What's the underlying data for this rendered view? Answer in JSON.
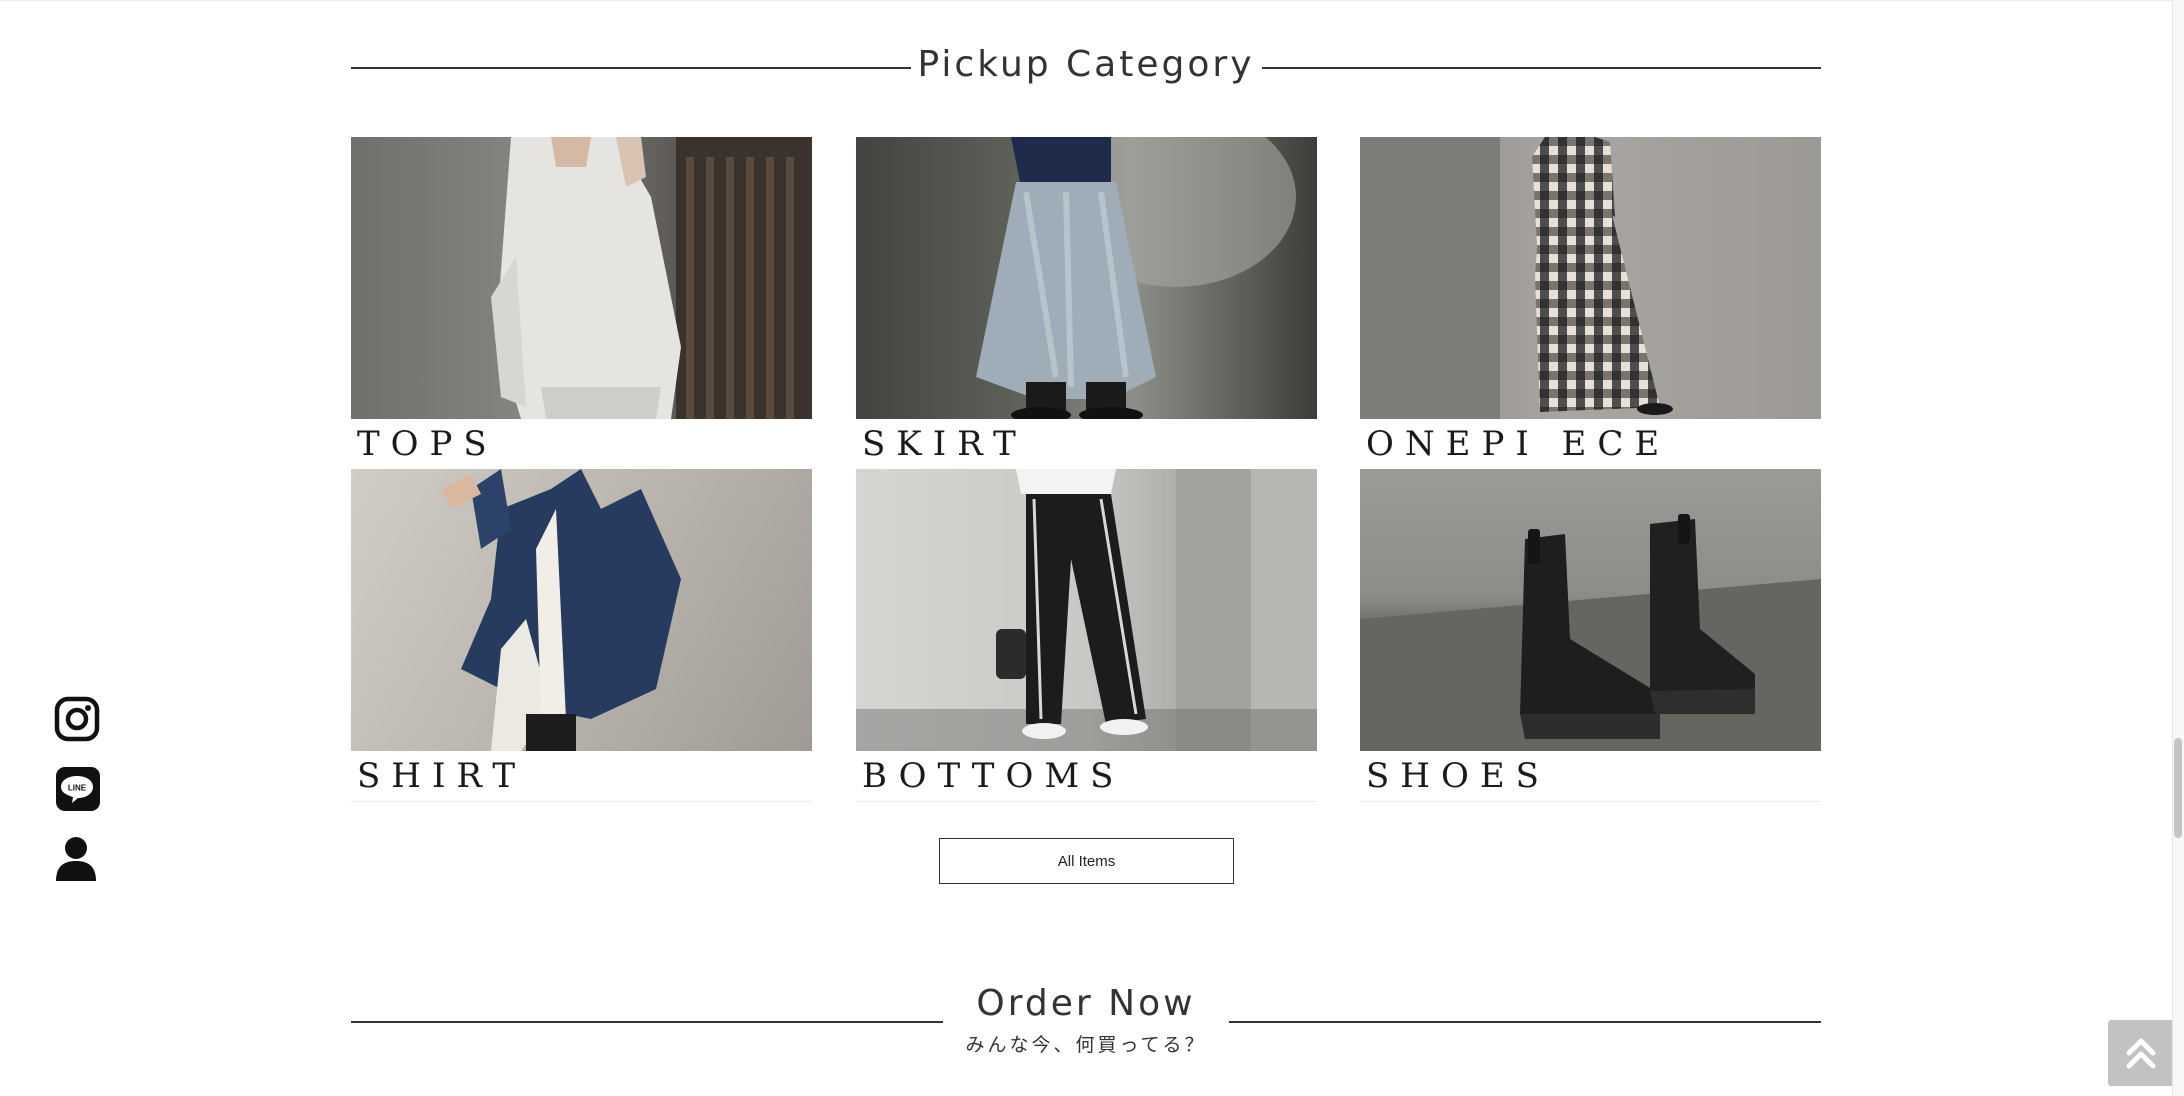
{
  "pickup": {
    "title": "Pickup Category"
  },
  "categories": [
    {
      "label": "TOPS",
      "image": "woman in oversized white sweatshirt"
    },
    {
      "label": "SKIRT",
      "image": "pale blue tulle skirt with black boots"
    },
    {
      "label": "ONEPI ECE",
      "image": "black and white gingham dress"
    },
    {
      "label": "SHIRT",
      "image": "denim jacket over white shirt"
    },
    {
      "label": "BOTTOMS",
      "image": "black wide pants with white piping"
    },
    {
      "label": "SHOES",
      "image": "black leather ankle boots"
    }
  ],
  "all_items": {
    "label": "All Items"
  },
  "order": {
    "title": "Order Now",
    "subtitle": "みんな今、何買ってる？"
  },
  "side_icons": [
    "instagram-icon",
    "line-icon",
    "user-icon"
  ],
  "colors": {
    "text": "#222222",
    "rule": "#333333",
    "to_top_bg": "#c2c2c2"
  }
}
